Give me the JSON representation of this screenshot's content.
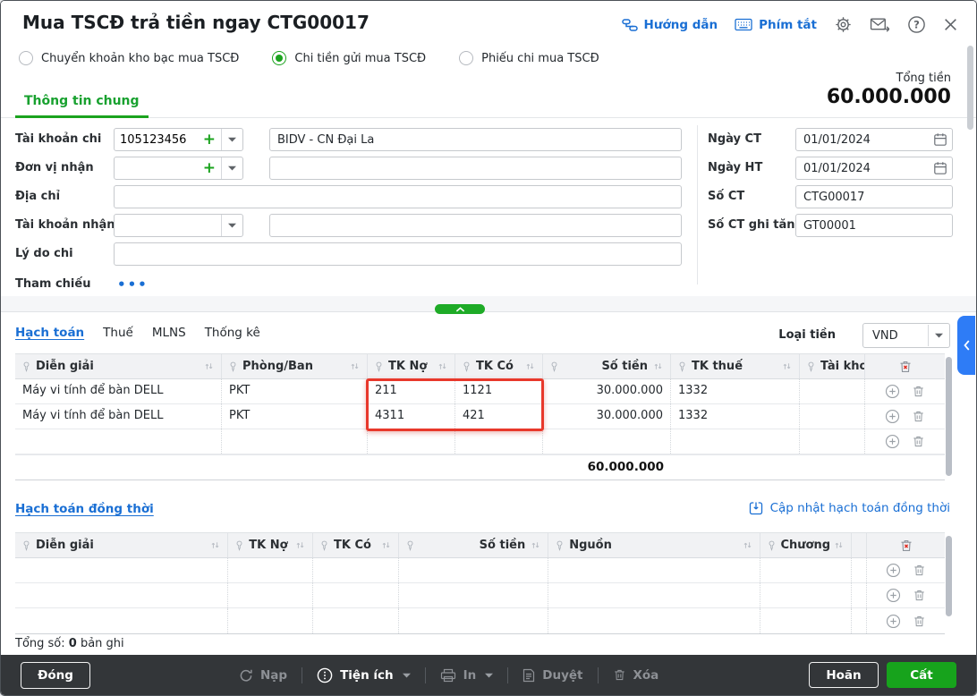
{
  "window": {
    "title": "Mua TSCĐ trả tiền ngay CTG00017"
  },
  "header": {
    "guide": "Hướng dẫn",
    "shortcuts": "Phím tắt"
  },
  "payment_types": [
    {
      "label": "Chuyển khoản kho bạc mua TSCĐ",
      "selected": false
    },
    {
      "label": "Chi tiền gửi mua TSCĐ",
      "selected": true
    },
    {
      "label": "Phiếu chi mua TSCĐ",
      "selected": false
    }
  ],
  "tabs": {
    "main": "Thông tin chung"
  },
  "total": {
    "label": "Tổng tiền",
    "value": "60.000.000"
  },
  "form": {
    "left": [
      {
        "label": "Tài khoản chi",
        "value": "105123456",
        "text": "BIDV - CN Đại La"
      },
      {
        "label": "Đơn vị nhận",
        "value": "",
        "text": ""
      },
      {
        "label": "Địa chỉ",
        "value": ""
      },
      {
        "label": "Tài khoản nhận",
        "value": "",
        "text": ""
      },
      {
        "label": "Lý do chi",
        "value": ""
      },
      {
        "label": "Tham chiếu",
        "more": "•••"
      }
    ],
    "right": [
      {
        "label": "Ngày CT",
        "value": "01/01/2024"
      },
      {
        "label": "Ngày HT",
        "value": "01/01/2024"
      },
      {
        "label": "Số CT",
        "value": "CTG00017"
      },
      {
        "label": "Số CT ghi tăng",
        "value": "GT00001"
      }
    ]
  },
  "detail": {
    "tabs": [
      {
        "label": "Hạch toán"
      },
      {
        "label": "Thuế"
      },
      {
        "label": "MLNS"
      },
      {
        "label": "Thống kê"
      }
    ],
    "currency_label": "Loại tiền",
    "currency": "VND"
  },
  "table1": {
    "columns": [
      "Diễn giải",
      "Phòng/Ban",
      "TK Nợ",
      "TK Có",
      "Số tiền",
      "TK thuế",
      "Tài kho"
    ],
    "rows": [
      [
        "Máy vi tính để bàn DELL",
        "PKT",
        "211",
        "1121",
        "30.000.000",
        "1332",
        ""
      ],
      [
        "Máy vi tính để bàn DELL",
        "PKT",
        "4311",
        "421",
        "30.000.000",
        "1332",
        ""
      ],
      [
        "",
        "",
        "",
        "",
        "",
        "",
        ""
      ]
    ],
    "total": "60.000.000"
  },
  "sim": {
    "title": "Hạch toán đồng thời",
    "update": "Cập nhật hạch toán đồng thời",
    "columns": [
      "Diễn giải",
      "TK Nợ",
      "TK Có",
      "Số tiền",
      "Nguồn",
      "Chương"
    ],
    "footer": {
      "prefix": "Tổng số:",
      "count": "0",
      "suffix": "bản ghi"
    }
  },
  "bar": {
    "close": "Đóng",
    "reload": "Nạp",
    "utilities": "Tiện ích",
    "print": "In",
    "approve": "Duyệt",
    "delete": "Xóa",
    "postpone": "Hoãn",
    "save": "Cất"
  },
  "colors": {
    "accent_green": "#1ba31e",
    "link_blue": "#1a6fd4",
    "annotation_red": "#e8382b",
    "side_tab_blue": "#2e7cf6",
    "bottom_bar": "#333639"
  }
}
